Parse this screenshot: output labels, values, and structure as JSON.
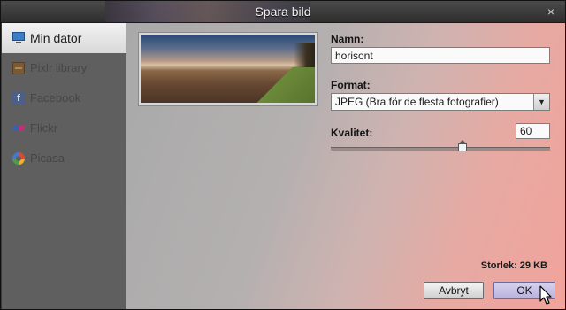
{
  "window": {
    "title": "Spara bild",
    "close_glyph": "×"
  },
  "sidebar": {
    "items": [
      {
        "label": "Min dator",
        "icon": "monitor-icon",
        "active": true
      },
      {
        "label": "Pixlr library",
        "icon": "pixlr-library-icon",
        "active": false
      },
      {
        "label": "Facebook",
        "icon": "facebook-icon",
        "active": false
      },
      {
        "label": "Flickr",
        "icon": "flickr-icon",
        "active": false
      },
      {
        "label": "Picasa",
        "icon": "picasa-icon",
        "active": false
      }
    ]
  },
  "form": {
    "name_label": "Namn:",
    "name_value": "horisont",
    "format_label": "Format:",
    "format_value": "JPEG (Bra för de flesta fotografier)",
    "quality_label": "Kvalitet:",
    "quality_value": "60",
    "quality_level": 0.6,
    "size_text": "Storlek: 29 KB"
  },
  "buttons": {
    "cancel": "Avbryt",
    "ok": "OK"
  },
  "colors": {
    "accent_pink": "#f1a39b",
    "sidebar_bg": "#5f5f5f",
    "ok_button": "#c6c0e6"
  }
}
